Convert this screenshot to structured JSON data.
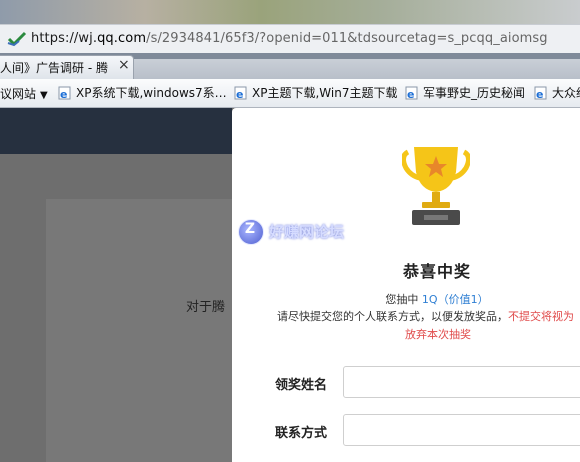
{
  "browser": {
    "address": {
      "prefix": "https://wj.",
      "domain": "qq.com",
      "rest": "/s/2934841/65f3/?openid=011&tdsourcetag=s_pcqq_aiomsg"
    },
    "tab": {
      "title": "人间》广告调研 - 腾",
      "close": "×"
    },
    "favorites": {
      "first_label": "议网站",
      "caret": "▼",
      "items": [
        {
          "label": "XP系统下载,windows7系…"
        },
        {
          "label": "XP主题下载,Win7主题下载"
        },
        {
          "label": "军事野史_历史秘闻"
        },
        {
          "label": "大众纱"
        }
      ]
    }
  },
  "background_page": {
    "text": "对于腾"
  },
  "modal": {
    "title": "恭喜中奖",
    "win_prefix": "您抽中 ",
    "prize": "1Q（价值1）",
    "instruction": "请尽快提交您的个人联系方式，以便发放奖品，",
    "warning_part1": "不提交将视为",
    "warning_part2": "放弃本次抽奖",
    "fields": [
      {
        "label": "领奖姓名",
        "value": ""
      },
      {
        "label": "联系方式",
        "value": ""
      }
    ],
    "trophy_color": "#f5c518",
    "star_color": "#e8872a"
  },
  "watermark": {
    "badge": "Z",
    "text": "好赚网论坛"
  }
}
